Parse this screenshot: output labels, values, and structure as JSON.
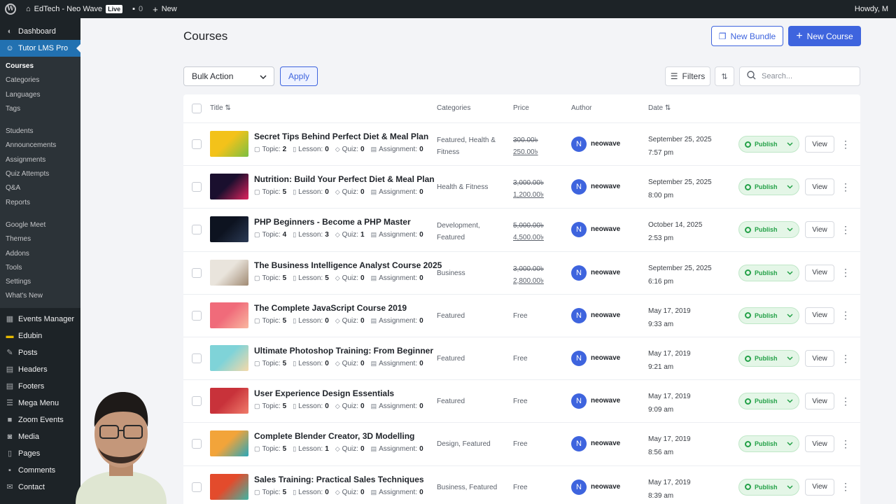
{
  "adminbar": {
    "site_name": "EdTech - Neo Wave",
    "live_badge": "Live",
    "comments_count": "0",
    "new_label": "New",
    "howdy": "Howdy, M"
  },
  "sidebar": {
    "top_items": [
      {
        "label": "Dashboard",
        "icon": "dashboard-icon"
      },
      {
        "label": "Tutor LMS Pro",
        "icon": "tutor-icon"
      }
    ],
    "submenu": [
      "Courses",
      "Categories",
      "Languages",
      "Tags",
      "Students",
      "Announcements",
      "Assignments",
      "Quiz Attempts",
      "Q&A",
      "Reports",
      "Google Meet",
      "Themes",
      "Addons",
      "Tools",
      "Settings",
      "What's New"
    ],
    "bottom_items": [
      {
        "label": "Events Manager",
        "icon": "calendar-icon"
      },
      {
        "label": "Edubin",
        "icon": "edubin-icon"
      },
      {
        "label": "Posts",
        "icon": "pin-icon"
      },
      {
        "label": "Headers",
        "icon": "header-icon"
      },
      {
        "label": "Footers",
        "icon": "footer-icon"
      },
      {
        "label": "Mega Menu",
        "icon": "menu-icon"
      },
      {
        "label": "Zoom Events",
        "icon": "video-icon"
      },
      {
        "label": "Media",
        "icon": "media-icon"
      },
      {
        "label": "Pages",
        "icon": "pages-icon"
      },
      {
        "label": "Comments",
        "icon": "comment-icon"
      },
      {
        "label": "Contact",
        "icon": "mail-icon"
      }
    ]
  },
  "header": {
    "title": "Courses",
    "new_bundle": "New Bundle",
    "new_course": "New Course"
  },
  "toolbar": {
    "bulk_action": "Bulk Action",
    "apply": "Apply",
    "filters": "Filters",
    "search_placeholder": "Search..."
  },
  "table": {
    "columns": {
      "title": "Title",
      "categories": "Categories",
      "price": "Price",
      "author": "Author",
      "date": "Date"
    },
    "meta_labels": {
      "topic": "Topic:",
      "lesson": "Lesson:",
      "quiz": "Quiz:",
      "assignment": "Assignment:"
    },
    "rows": [
      {
        "title": "Secret Tips Behind Perfect Diet & Meal Plan",
        "topic": "2",
        "lesson": "0",
        "quiz": "0",
        "assignment": "0",
        "cat1": "Featured, Health &",
        "cat2": "Fitness",
        "price_old": "300.00৳",
        "price_new": "250.00৳",
        "author": "neowave",
        "date": "September 25, 2025",
        "time": "7:57 pm",
        "status": "Publish",
        "view": "View",
        "avatar": "N",
        "thumb": [
          "#f3c21a",
          "#7bc043"
        ]
      },
      {
        "title": "Nutrition: Build Your Perfect Diet & Meal Plan",
        "topic": "5",
        "lesson": "0",
        "quiz": "0",
        "assignment": "0",
        "cat1": "Health & Fitness",
        "cat2": "",
        "price_old": "3,000.00৳",
        "price_new": "1,200.00৳",
        "author": "neowave",
        "date": "September 25, 2025",
        "time": "8:00 pm",
        "status": "Publish",
        "view": "View",
        "avatar": "N",
        "thumb": [
          "#1a0f2e",
          "#e0245e"
        ]
      },
      {
        "title": "PHP Beginners - Become a PHP Master",
        "topic": "4",
        "lesson": "3",
        "quiz": "1",
        "assignment": "0",
        "cat1": "Development,",
        "cat2": "Featured",
        "price_old": "5,000.00৳",
        "price_new": "4,500.00৳",
        "author": "neowave",
        "date": "October 14, 2025",
        "time": "2:53 pm",
        "status": "Publish",
        "view": "View",
        "avatar": "N",
        "thumb": [
          "#0d1320",
          "#2b3a55"
        ]
      },
      {
        "title": "The Business Intelligence Analyst Course 2025",
        "topic": "5",
        "lesson": "5",
        "quiz": "0",
        "assignment": "0",
        "cat1": "Business",
        "cat2": "",
        "price_old": "3,000.00৳",
        "price_new": "2,800.00৳",
        "author": "neowave",
        "date": "September 25, 2025",
        "time": "6:16 pm",
        "status": "Publish",
        "view": "View",
        "avatar": "N",
        "thumb": [
          "#e9e4dc",
          "#a08a73"
        ]
      },
      {
        "title": "The Complete JavaScript Course 2019",
        "topic": "5",
        "lesson": "0",
        "quiz": "0",
        "assignment": "0",
        "cat1": "Featured",
        "cat2": "",
        "price_old": "",
        "price_new": "Free",
        "author": "neowave",
        "date": "May 17, 2019",
        "time": "9:33 am",
        "status": "Publish",
        "view": "View",
        "avatar": "N",
        "thumb": [
          "#f06b7a",
          "#f9b8a0"
        ]
      },
      {
        "title": "Ultimate Photoshop Training: From Beginner",
        "topic": "5",
        "lesson": "0",
        "quiz": "0",
        "assignment": "0",
        "cat1": "Featured",
        "cat2": "",
        "price_old": "",
        "price_new": "Free",
        "author": "neowave",
        "date": "May 17, 2019",
        "time": "9:21 am",
        "status": "Publish",
        "view": "View",
        "avatar": "N",
        "thumb": [
          "#7fd3d8",
          "#f5d9a8"
        ]
      },
      {
        "title": "User Experience Design Essentials",
        "topic": "5",
        "lesson": "0",
        "quiz": "0",
        "assignment": "0",
        "cat1": "Featured",
        "cat2": "",
        "price_old": "",
        "price_new": "Free",
        "author": "neowave",
        "date": "May 17, 2019",
        "time": "9:09 am",
        "status": "Publish",
        "view": "View",
        "avatar": "N",
        "thumb": [
          "#c8323a",
          "#f07c6b"
        ]
      },
      {
        "title": "Complete Blender Creator, 3D Modelling",
        "topic": "5",
        "lesson": "1",
        "quiz": "0",
        "assignment": "0",
        "cat1": "Design, Featured",
        "cat2": "",
        "price_old": "",
        "price_new": "Free",
        "author": "neowave",
        "date": "May 17, 2019",
        "time": "8:56 am",
        "status": "Publish",
        "view": "View",
        "avatar": "N",
        "thumb": [
          "#f2a43a",
          "#2aa6b8"
        ]
      },
      {
        "title": "Sales Training: Practical Sales Techniques",
        "topic": "5",
        "lesson": "0",
        "quiz": "0",
        "assignment": "0",
        "cat1": "Business, Featured",
        "cat2": "",
        "price_old": "",
        "price_new": "Free",
        "author": "neowave",
        "date": "May 17, 2019",
        "time": "8:39 am",
        "status": "Publish",
        "view": "View",
        "avatar": "N",
        "thumb": [
          "#e34b2c",
          "#3fb5a3"
        ]
      }
    ]
  },
  "colors": {
    "brand": "#3e64de",
    "publish_green": "#24a148",
    "admin_dark": "#1d2327",
    "wp_blue": "#2271b1"
  }
}
